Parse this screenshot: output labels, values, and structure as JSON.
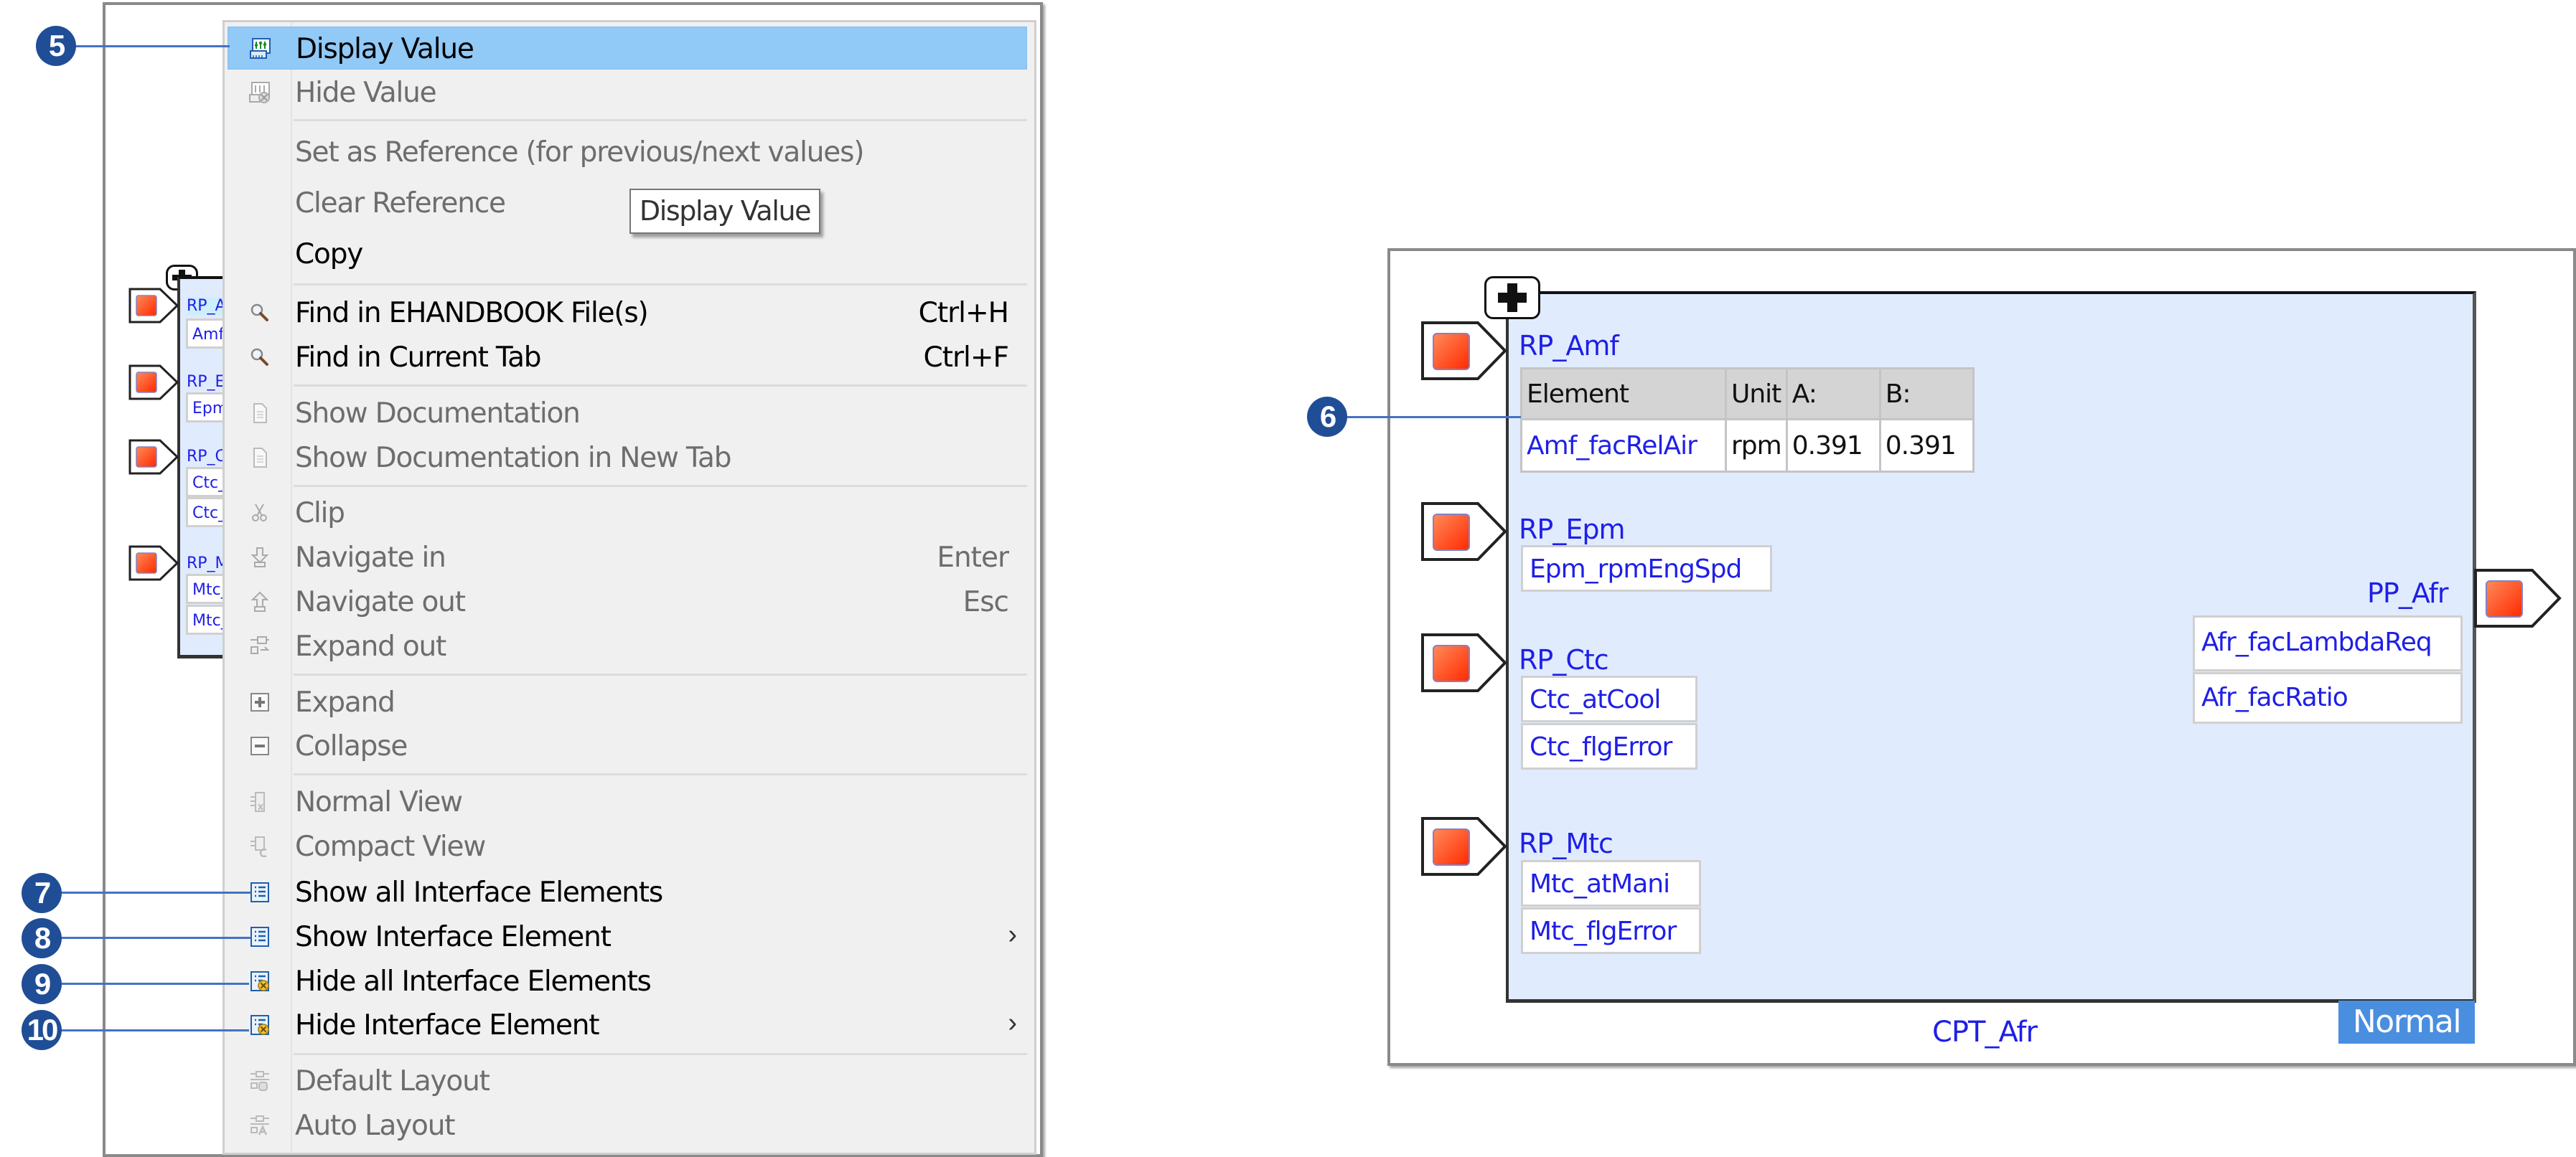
{
  "callouts": {
    "c5": "5",
    "c6": "6",
    "c7": "7",
    "c8": "8",
    "c9": "9",
    "c10": "10"
  },
  "context_menu": {
    "items": [
      {
        "label": "Display Value",
        "icon": "display-value-icon",
        "enabled": true,
        "highlighted": true
      },
      {
        "label": "Hide Value",
        "icon": "hide-value-icon",
        "enabled": false
      },
      {
        "label": "Set as Reference (for previous/next values)",
        "icon": "",
        "enabled": false
      },
      {
        "label": "Clear Reference",
        "icon": "",
        "enabled": false
      },
      {
        "label": "Copy",
        "icon": "",
        "enabled": true
      },
      {
        "label": "Find in EHANDBOOK File(s)",
        "icon": "search-icon",
        "enabled": true,
        "shortcut": "Ctrl+H"
      },
      {
        "label": "Find in Current Tab",
        "icon": "search-icon",
        "enabled": true,
        "shortcut": "Ctrl+F"
      },
      {
        "label": "Show Documentation",
        "icon": "document-icon",
        "enabled": false
      },
      {
        "label": "Show Documentation in New Tab",
        "icon": "document-icon",
        "enabled": false
      },
      {
        "label": "Clip",
        "icon": "clip-icon",
        "enabled": false
      },
      {
        "label": "Navigate in",
        "icon": "navigate-in-icon",
        "enabled": false,
        "shortcut": "Enter"
      },
      {
        "label": "Navigate out",
        "icon": "navigate-out-icon",
        "enabled": false,
        "shortcut": "Esc"
      },
      {
        "label": "Expand out",
        "icon": "expand-out-icon",
        "enabled": false
      },
      {
        "label": "Expand",
        "icon": "expand-icon",
        "enabled": false
      },
      {
        "label": "Collapse",
        "icon": "collapse-icon",
        "enabled": false
      },
      {
        "label": "Normal View",
        "icon": "normal-view-icon",
        "enabled": false
      },
      {
        "label": "Compact View",
        "icon": "compact-view-icon",
        "enabled": false
      },
      {
        "label": "Show all Interface Elements",
        "icon": "list-icon",
        "enabled": true
      },
      {
        "label": "Show Interface Element",
        "icon": "list-icon",
        "enabled": true,
        "submenu": true
      },
      {
        "label": "Hide all Interface Elements",
        "icon": "list-hide-icon",
        "enabled": true
      },
      {
        "label": "Hide Interface Element",
        "icon": "list-hide-icon",
        "enabled": true,
        "submenu": true
      },
      {
        "label": "Default Layout",
        "icon": "default-layout-icon",
        "enabled": false
      },
      {
        "label": "Auto Layout",
        "icon": "auto-layout-icon",
        "enabled": false
      }
    ],
    "submenu_arrow": "›",
    "tooltip": "Display Value"
  },
  "mini_diagram": {
    "ports": [
      {
        "name": "RP_A",
        "fields": [
          "Amf"
        ]
      },
      {
        "name": "RP_E",
        "fields": [
          "Epm"
        ]
      },
      {
        "name": "RP_C",
        "fields": [
          "Ctc_",
          "Ctc_"
        ]
      },
      {
        "name": "RP_M",
        "fields": [
          "Mtc_",
          "Mtc_"
        ]
      }
    ]
  },
  "component": {
    "title": "CPT_Afr",
    "mode_badge": "Normal",
    "ports_in": [
      {
        "name": "RP_Amf"
      },
      {
        "name": "RP_Epm",
        "fields": [
          "Epm_rpmEngSpd"
        ]
      },
      {
        "name": "RP_Ctc",
        "fields": [
          "Ctc_atCool",
          "Ctc_flgError"
        ]
      },
      {
        "name": "RP_Mtc",
        "fields": [
          "Mtc_atMani",
          "Mtc_flgError"
        ]
      }
    ],
    "port_out": {
      "name": "PP_Afr",
      "fields": [
        "Afr_facLambdaReq",
        "Afr_facRatio"
      ]
    },
    "value_table": {
      "headers": [
        "Element",
        "Unit",
        "A:",
        "B:"
      ],
      "rows": [
        [
          "Amf_facRelAir",
          "rpm",
          "0.391",
          "0.391"
        ]
      ]
    }
  },
  "colors": {
    "highlight": "#91c9f7",
    "callout": "#1f4e96",
    "port_name": "#1f1fe6",
    "block_fill": "#e0ecfd",
    "badge": "#4a8ee0",
    "port_square": "#ff4a1a"
  }
}
